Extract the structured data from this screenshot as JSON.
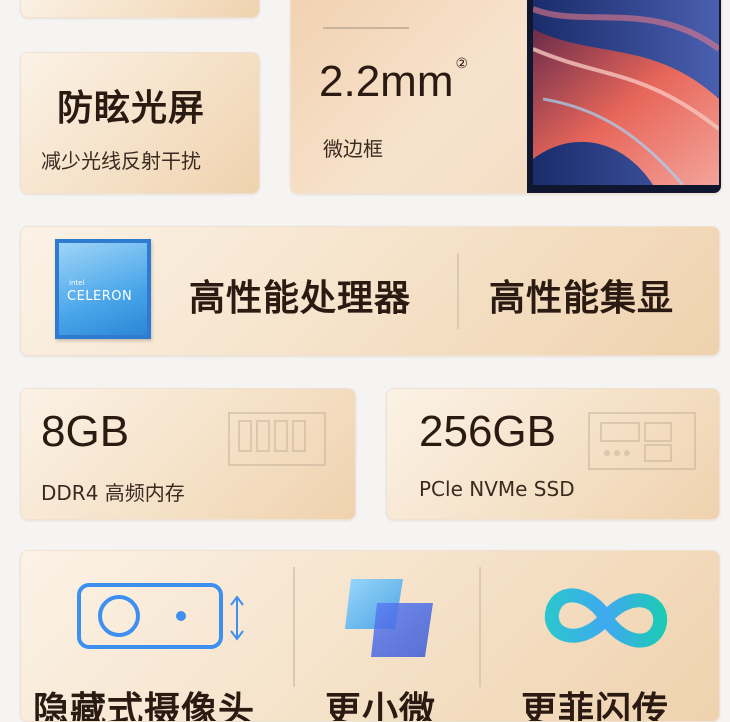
{
  "antiglare": {
    "title": "防眩光屏",
    "subtitle": "减少光线反射干扰"
  },
  "bezel": {
    "value": "2.2mm",
    "sup": "②",
    "label": "微边框"
  },
  "processor": {
    "badge_brand": "intel",
    "badge_model": "CELERON",
    "title": "高性能处理器",
    "graphics": "高性能集显"
  },
  "memory": {
    "size": "8GB",
    "desc": "DDR4 高频内存"
  },
  "storage": {
    "size": "256GB",
    "desc": "PCle NVMe SSD"
  },
  "features": [
    {
      "label": "隐藏式摄像头",
      "icon": "hidden-camera-icon"
    },
    {
      "label": "更小微",
      "icon": "stacked-squares-icon"
    },
    {
      "label": "更菲闪传",
      "icon": "infinity-loop-icon"
    }
  ],
  "colors": {
    "accent_blue": "#3d8ff0",
    "text_dark": "#2a1a12"
  }
}
